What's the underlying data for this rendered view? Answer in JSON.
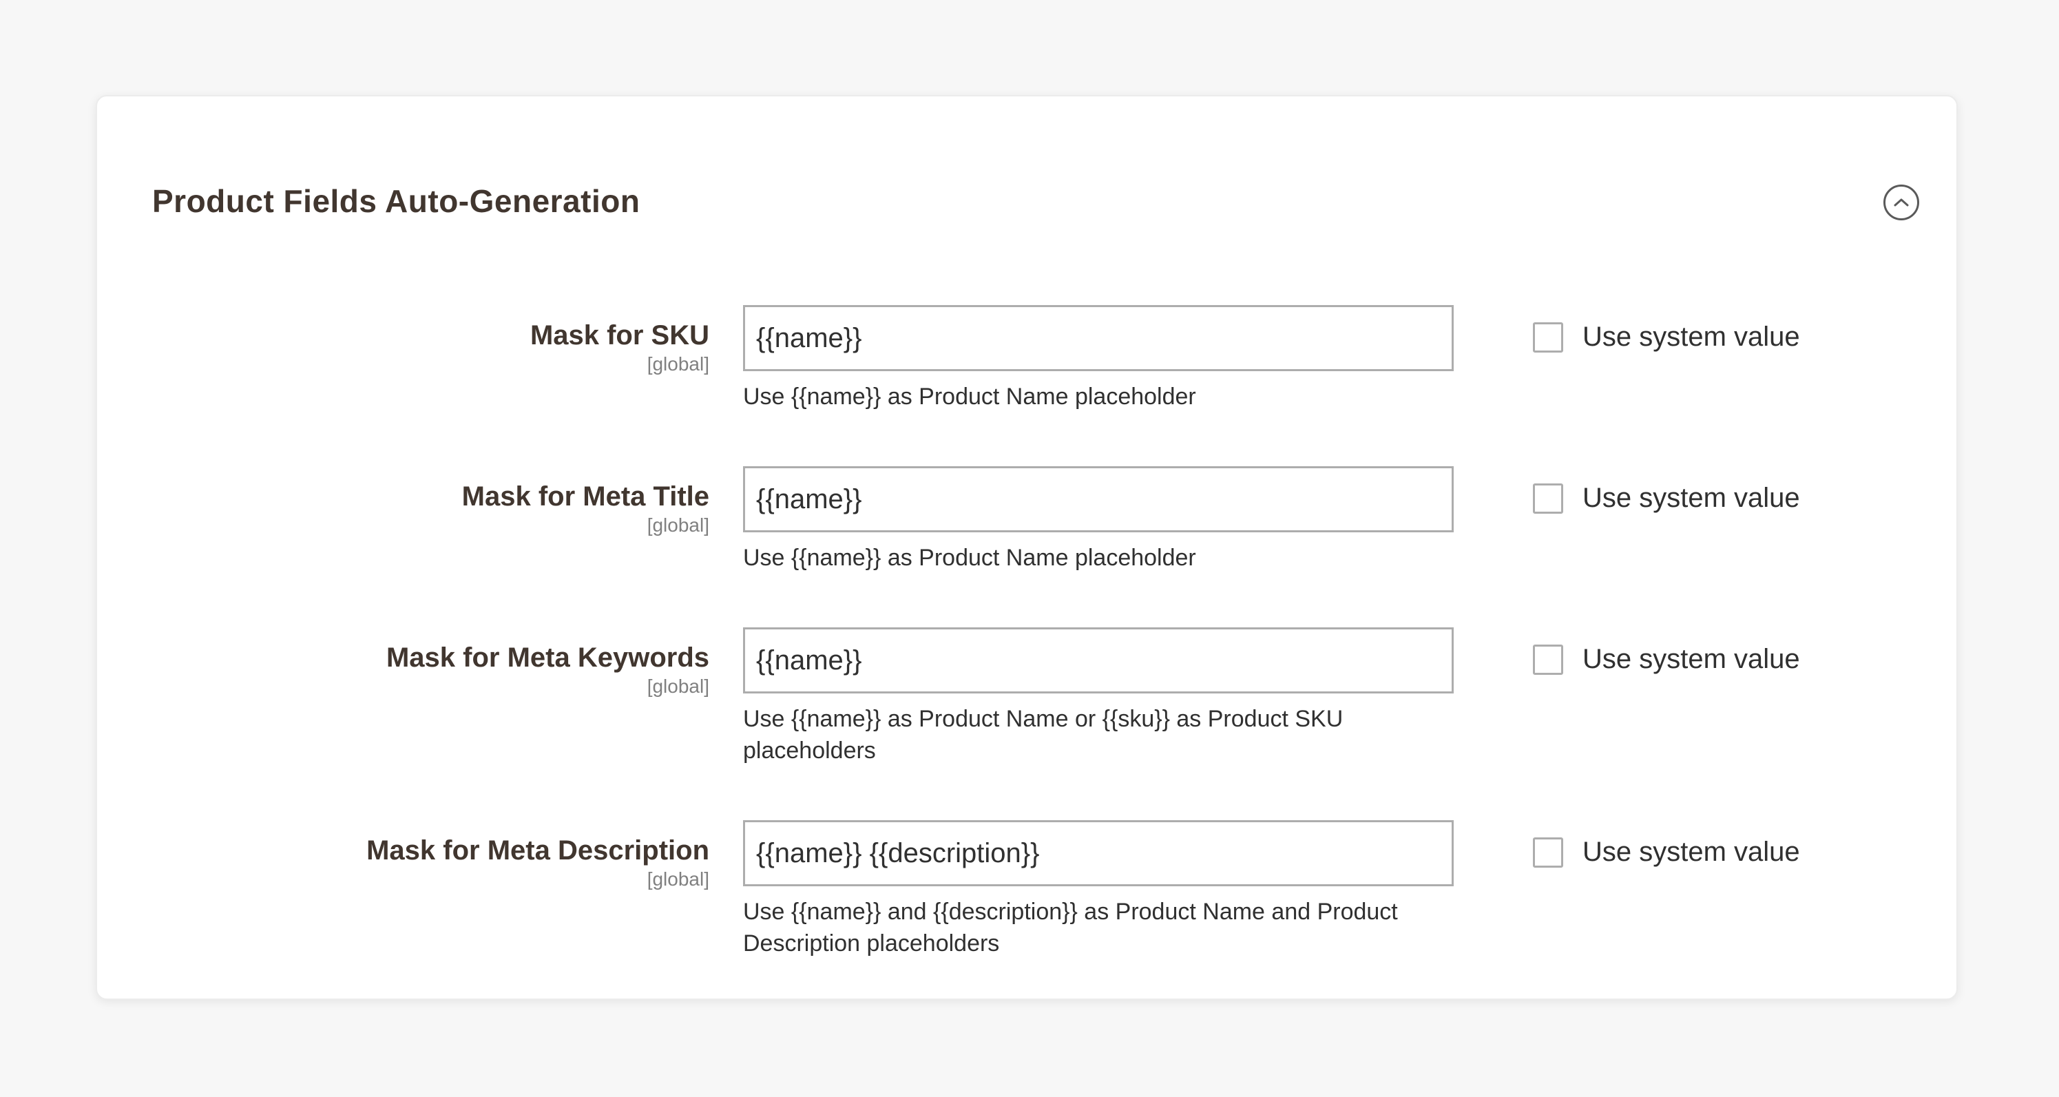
{
  "section": {
    "title": "Product Fields Auto-Generation"
  },
  "fields": [
    {
      "label": "Mask for SKU",
      "scope": "[global]",
      "value": "{{name}}",
      "note": "Use {{name}} as Product Name placeholder",
      "use_system_label": "Use system value",
      "use_system_checked": false
    },
    {
      "label": "Mask for Meta Title",
      "scope": "[global]",
      "value": "{{name}}",
      "note": "Use {{name}} as Product Name placeholder",
      "use_system_label": "Use system value",
      "use_system_checked": false
    },
    {
      "label": "Mask for Meta Keywords",
      "scope": "[global]",
      "value": "{{name}}",
      "note": "Use {{name}} as Product Name or {{sku}} as Product SKU placeholders",
      "use_system_label": "Use system value",
      "use_system_checked": false
    },
    {
      "label": "Mask for Meta Description",
      "scope": "[global]",
      "value": "{{name}} {{description}}",
      "note": "Use {{name}} and {{description}} as Product Name and Product Description placeholders",
      "use_system_label": "Use system value",
      "use_system_checked": false
    }
  ]
}
